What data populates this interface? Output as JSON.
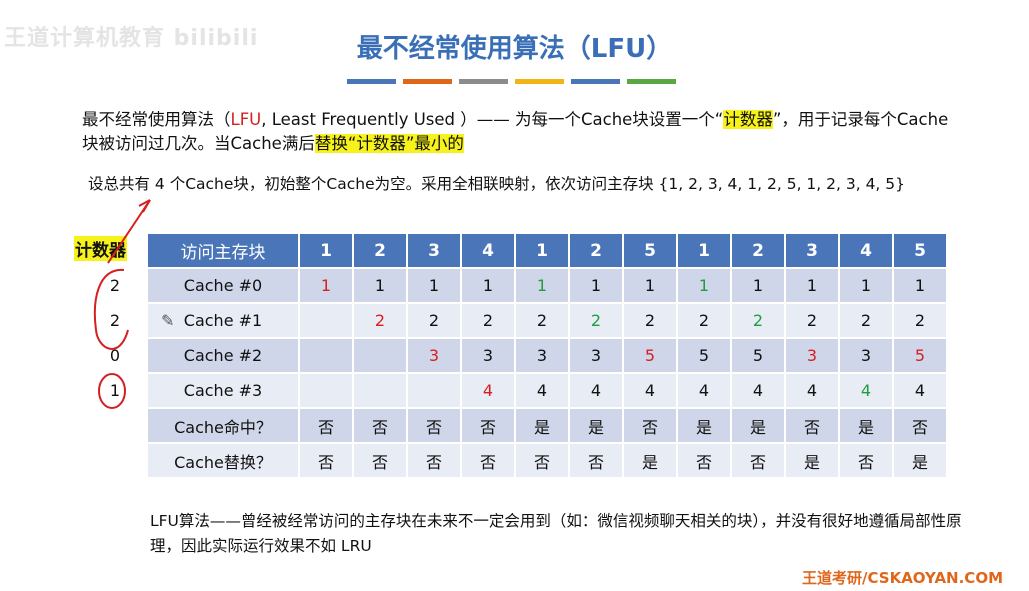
{
  "watermark": "王道计算机教育 bilibili",
  "title": "最不经常使用算法（LFU）",
  "accent_bars": [
    "#4a76b9",
    "#e0661b",
    "#8c8c8c",
    "#f2b515",
    "#4a76b9",
    "#5aa842"
  ],
  "intro": {
    "part1": "最不经常使用算法（",
    "lfu": "LFU",
    "part2": ", Least Frequently Used ）—— 为每一个Cache块设置一个“",
    "hl1": "计数器",
    "part3": "”，用于记录每个Cache块被访问过几次。当Cache满后",
    "hl2": "替换“计数器”最小的"
  },
  "setup": "设总共有 4 个Cache块，初始整个Cache为空。采用全相联映射，依次访问主存块 {1, 2, 3, 4, 1, 2, 5, 1, 2, 3, 4, 5}",
  "counter_label": "计数器",
  "counters": [
    "2",
    "2",
    "0",
    "1"
  ],
  "table": {
    "header_label": "访问主存块",
    "sequence": [
      "1",
      "2",
      "3",
      "4",
      "1",
      "2",
      "5",
      "1",
      "2",
      "3",
      "4",
      "5"
    ],
    "rows": [
      {
        "label": "Cache #0",
        "cells": [
          {
            "v": "1",
            "c": "r"
          },
          {
            "v": "1"
          },
          {
            "v": "1"
          },
          {
            "v": "1"
          },
          {
            "v": "1",
            "c": "g"
          },
          {
            "v": "1"
          },
          {
            "v": "1"
          },
          {
            "v": "1",
            "c": "g"
          },
          {
            "v": "1"
          },
          {
            "v": "1"
          },
          {
            "v": "1"
          },
          {
            "v": "1"
          }
        ]
      },
      {
        "label": "Cache #1",
        "cells": [
          {
            "v": ""
          },
          {
            "v": "2",
            "c": "r"
          },
          {
            "v": "2"
          },
          {
            "v": "2"
          },
          {
            "v": "2"
          },
          {
            "v": "2",
            "c": "g"
          },
          {
            "v": "2"
          },
          {
            "v": "2"
          },
          {
            "v": "2",
            "c": "g"
          },
          {
            "v": "2"
          },
          {
            "v": "2"
          },
          {
            "v": "2"
          }
        ]
      },
      {
        "label": "Cache #2",
        "cells": [
          {
            "v": ""
          },
          {
            "v": ""
          },
          {
            "v": "3",
            "c": "r"
          },
          {
            "v": "3"
          },
          {
            "v": "3"
          },
          {
            "v": "3"
          },
          {
            "v": "5",
            "c": "r"
          },
          {
            "v": "5"
          },
          {
            "v": "5"
          },
          {
            "v": "3",
            "c": "r"
          },
          {
            "v": "3"
          },
          {
            "v": "5",
            "c": "r"
          }
        ]
      },
      {
        "label": "Cache #3",
        "cells": [
          {
            "v": ""
          },
          {
            "v": ""
          },
          {
            "v": ""
          },
          {
            "v": "4",
            "c": "r"
          },
          {
            "v": "4"
          },
          {
            "v": "4"
          },
          {
            "v": "4"
          },
          {
            "v": "4"
          },
          {
            "v": "4"
          },
          {
            "v": "4"
          },
          {
            "v": "4",
            "c": "g"
          },
          {
            "v": "4"
          }
        ]
      },
      {
        "label": "Cache命中？",
        "cells": [
          {
            "v": "否"
          },
          {
            "v": "否"
          },
          {
            "v": "否"
          },
          {
            "v": "否"
          },
          {
            "v": "是"
          },
          {
            "v": "是"
          },
          {
            "v": "否"
          },
          {
            "v": "是"
          },
          {
            "v": "是"
          },
          {
            "v": "否"
          },
          {
            "v": "是"
          },
          {
            "v": "否"
          }
        ]
      },
      {
        "label": "Cache替换？",
        "cells": [
          {
            "v": "否"
          },
          {
            "v": "否"
          },
          {
            "v": "否"
          },
          {
            "v": "否"
          },
          {
            "v": "否"
          },
          {
            "v": "否"
          },
          {
            "v": "是"
          },
          {
            "v": "否"
          },
          {
            "v": "否"
          },
          {
            "v": "是"
          },
          {
            "v": "否"
          },
          {
            "v": "是"
          }
        ]
      }
    ]
  },
  "conclusion": "LFU算法——曾经被经常访问的主存块在未来不一定会用到（如：微信视频聊天相关的块），并没有很好地遵循局部性原理，因此实际运行效果不如 LRU",
  "footer": "王道考研/CSKAOYAN.COM",
  "pencil_icon": "pencil-icon"
}
